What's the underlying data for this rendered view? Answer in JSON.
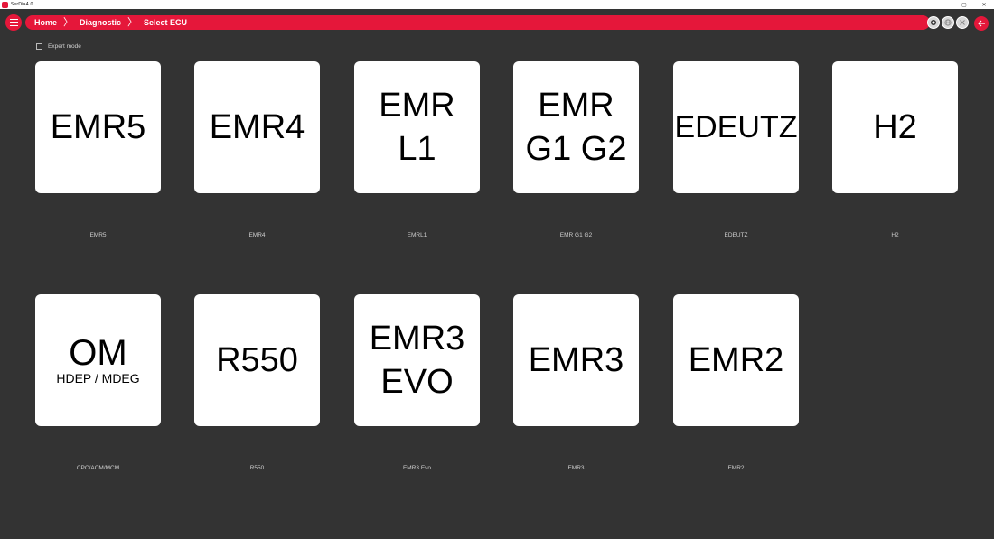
{
  "window": {
    "title": "SerDia4.0",
    "minimize_glyph": "–",
    "maximize_glyph": "▢",
    "close_glyph": "✕"
  },
  "breadcrumb": [
    "Home",
    "Diagnostic",
    "Select ECU"
  ],
  "breadcrumb_separator": "〉",
  "expert_mode": {
    "label": "Expert mode",
    "checked": false
  },
  "ecus": [
    {
      "tile_lines": [
        "EMR5"
      ],
      "caption": "EMR5"
    },
    {
      "tile_lines": [
        "EMR4"
      ],
      "caption": "EMR4"
    },
    {
      "tile_lines": [
        "EMR",
        "L1"
      ],
      "caption": "EMRL1"
    },
    {
      "tile_lines": [
        "EMR",
        "G1 G2"
      ],
      "caption": "EMR G1 G2"
    },
    {
      "tile_lines": [
        "EDEUTZ"
      ],
      "caption": "EDEUTZ"
    },
    {
      "tile_lines": [
        "H2"
      ],
      "caption": "H2"
    },
    {
      "tile_lines": [
        "OM",
        "HDEP / MDEG"
      ],
      "caption": "CPC/ACM/MCM"
    },
    {
      "tile_lines": [
        "R550"
      ],
      "caption": "R550"
    },
    {
      "tile_lines": [
        "EMR3",
        "EVO"
      ],
      "caption": "EMR3 Evo"
    },
    {
      "tile_lines": [
        "EMR3"
      ],
      "caption": "EMR3"
    },
    {
      "tile_lines": [
        "EMR2"
      ],
      "caption": "EMR2"
    }
  ],
  "icons": {
    "menu": "hamburger-menu-icon",
    "record": "record-icon",
    "globe": "globe-icon",
    "close": "close-circle-icon",
    "back": "back-arrow-icon"
  },
  "colors": {
    "accent": "#e5173a",
    "background": "#333333",
    "tile": "#ffffff"
  }
}
